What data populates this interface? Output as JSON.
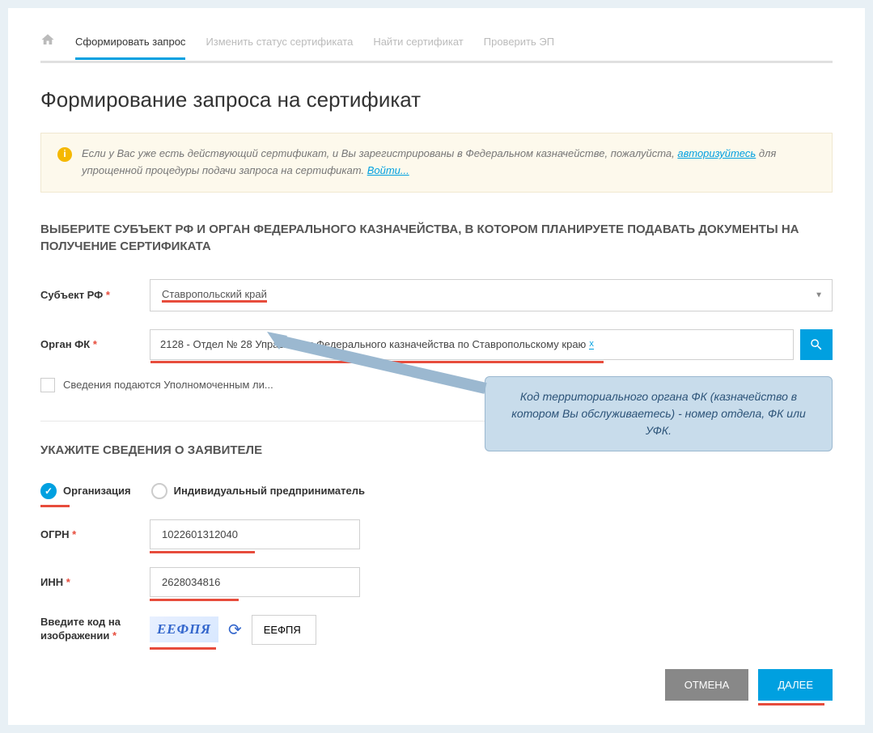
{
  "tabs": {
    "form_request": "Сформировать запрос",
    "change_status": "Изменить статус сертификата",
    "find_cert": "Найти сертификат",
    "verify_sig": "Проверить ЭП"
  },
  "page_title": "Формирование запроса на сертификат",
  "info": {
    "text_before": "Если у Вас уже есть действующий сертификат, и Вы зарегистрированы в Федеральном казначействе, пожалуйста, ",
    "link_auth": "авторизуйтесь",
    "text_after": " для упрощенной процедуры подачи запроса на сертификат. ",
    "link_login": "Войти..."
  },
  "section1": {
    "title": "ВЫБЕРИТЕ СУБЪЕКТ РФ И ОРГАН ФЕДЕРАЛЬНОГО КАЗНАЧЕЙСТВА, В КОТОРОМ ПЛАНИРУЕТЕ ПОДАВАТЬ ДОКУМЕНТЫ НА ПОЛУЧЕНИЕ СЕРТИФИКАТА",
    "subject_label": "Субъект РФ",
    "subject_value": "Ставропольский край",
    "organ_label": "Орган ФК",
    "organ_value": "2128 - Отдел № 28 Управления Федерального казначейства по Ставропольскому краю",
    "checkbox_label": "Сведения подаются Уполномоченным ли..."
  },
  "section2": {
    "title": "УКАЖИТЕ СВЕДЕНИЯ О ЗАЯВИТЕЛЕ",
    "radio_org": "Организация",
    "radio_ip": "Индивидуальный предприниматель",
    "ogrn_label": "ОГРН",
    "ogrn_value": "1022601312040",
    "inn_label": "ИНН",
    "inn_value": "2628034816",
    "captcha_label": "Введите код на изображении",
    "captcha_text": "ЕЕФПЯ",
    "captcha_value": "ЕЕФПЯ"
  },
  "buttons": {
    "cancel": "ОТМЕНА",
    "next": "ДАЛЕЕ"
  },
  "callout": "Код территориального органа ФК (казначейство в котором Вы обслуживаетесь) - номер отдела, ФК или УФК."
}
